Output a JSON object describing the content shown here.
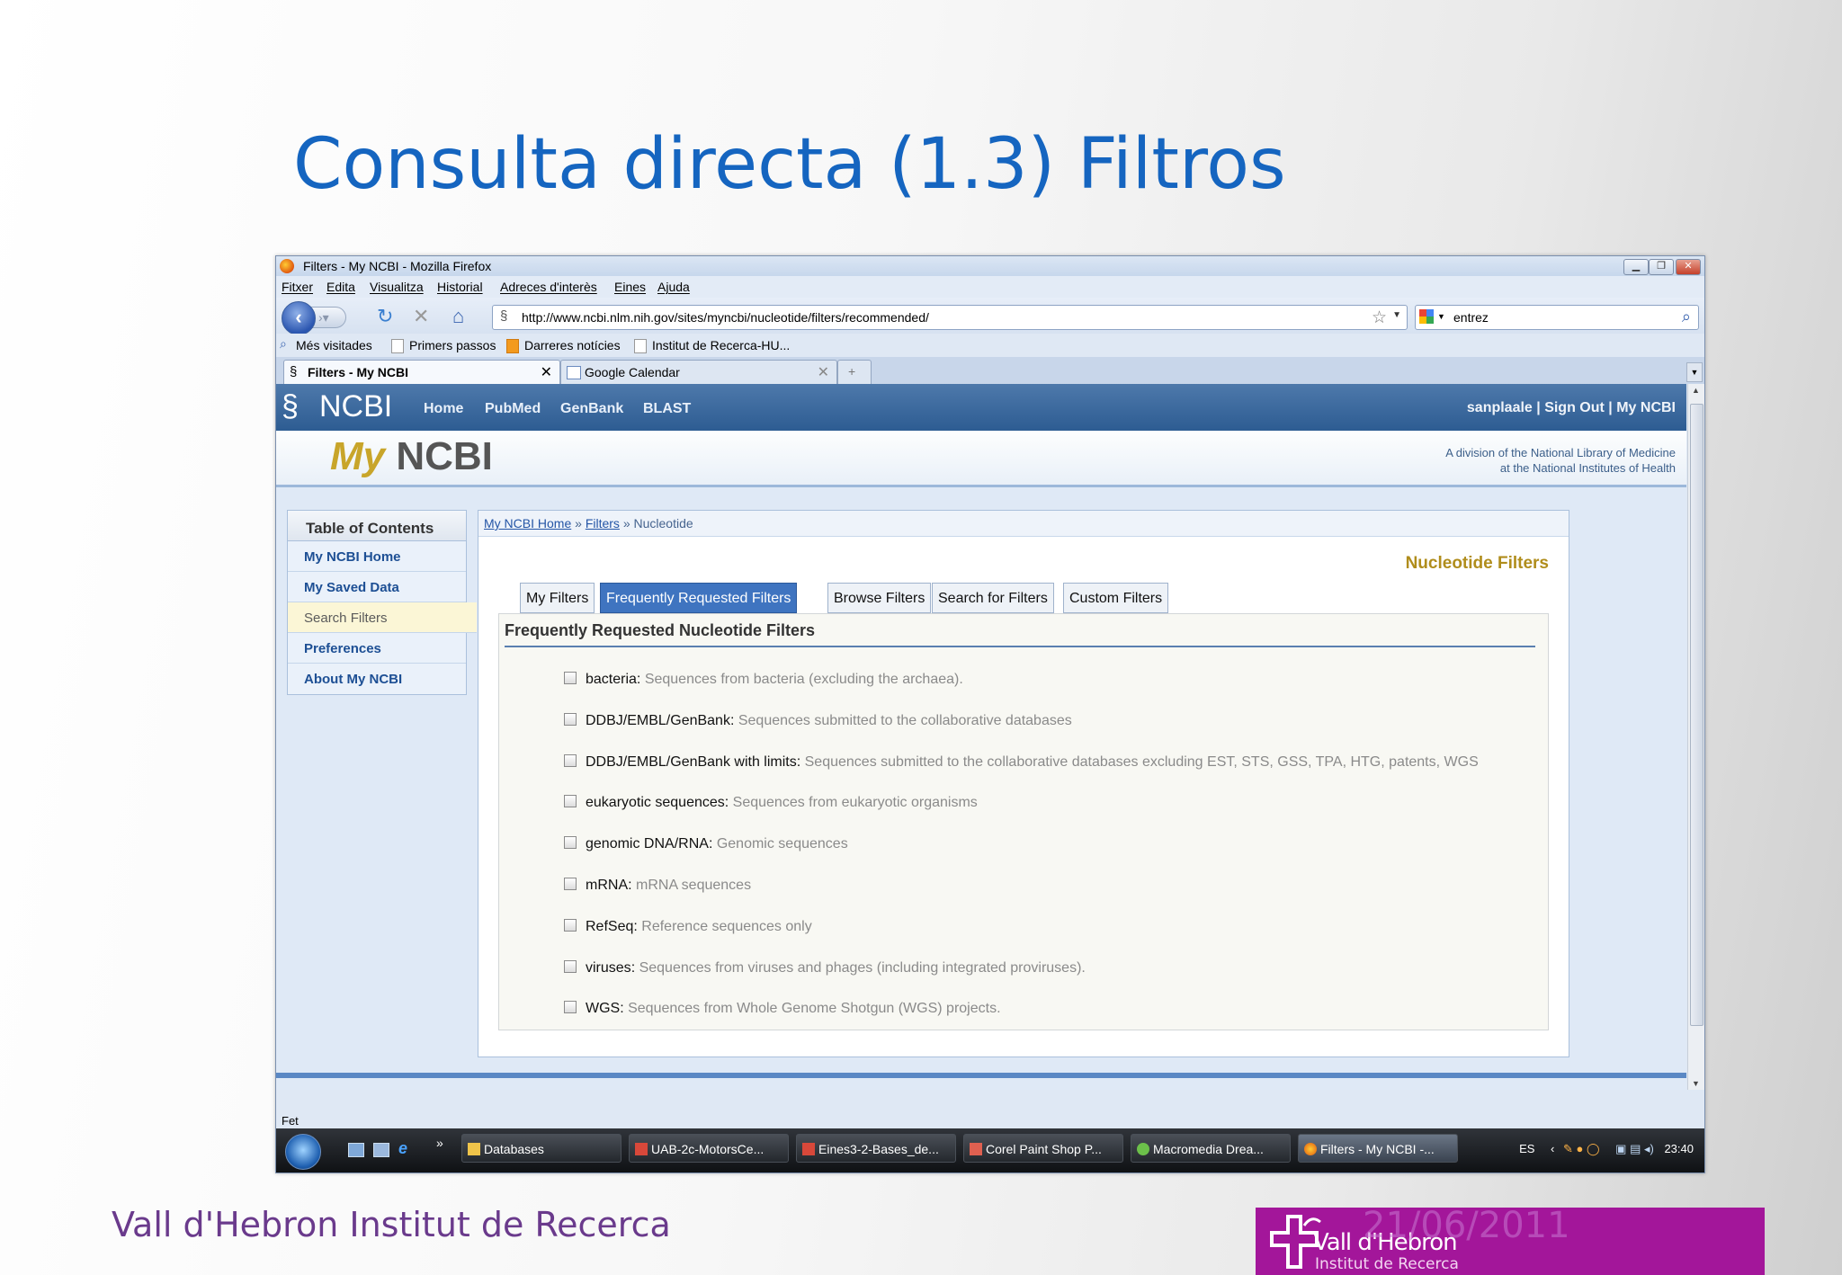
{
  "slide": {
    "title": "Consulta directa (1.3) Filtros",
    "footer_org": "Vall d'Hebron Institut de Recerca",
    "date": "21/06/2011",
    "logo_line1": "Vall d'Hebron",
    "logo_line2": "Institut de Recerca"
  },
  "browser": {
    "window_title": "Filters - My NCBI - Mozilla Firefox",
    "menu": [
      "Fitxer",
      "Edita",
      "Visualitza",
      "Historial",
      "Adreces d'interès",
      "Eines",
      "Ajuda"
    ],
    "url": "http://www.ncbi.nlm.nih.gov/sites/myncbi/nucleotide/filters/recommended/",
    "search_value": "entrez",
    "bookmarks": [
      "Més visitades",
      "Primers passos",
      "Darreres notícies",
      "Institut de Recerca-HU..."
    ],
    "tabs": [
      {
        "label": "Filters - My NCBI"
      },
      {
        "label": "Google Calendar"
      }
    ],
    "status": "Fet"
  },
  "ncbi": {
    "logo": "NCBI",
    "nav": [
      "Home",
      "PubMed",
      "GenBank",
      "BLAST"
    ],
    "user_links": "sanplaale | Sign Out | My NCBI",
    "myncbi_my": "My",
    "myncbi_ncbi": "NCBI",
    "division_line1": "A division of the National Library of Medicine",
    "division_line2": "at the National Institutes of Health"
  },
  "toc": {
    "heading": "Table of Contents",
    "items": [
      "My NCBI Home",
      "My Saved Data",
      "Search Filters",
      "Preferences",
      "About My NCBI"
    ]
  },
  "breadcrumb": {
    "home": "My NCBI Home",
    "sep1": "»",
    "filters": "Filters",
    "sep2": "»",
    "current": "Nucleotide"
  },
  "main": {
    "title": "Nucleotide Filters",
    "tabs": [
      "My Filters",
      "Frequently Requested Filters",
      "Browse Filters",
      "Search for Filters",
      "Custom Filters"
    ],
    "panel_heading": "Frequently Requested Nucleotide Filters",
    "filters": [
      {
        "name": "bacteria",
        "desc": "Sequences from bacteria (excluding the archaea)."
      },
      {
        "name": "DDBJ/EMBL/GenBank",
        "desc": "Sequences submitted to the collaborative databases"
      },
      {
        "name": "DDBJ/EMBL/GenBank with limits",
        "desc": "Sequences submitted to the collaborative databases excluding EST, STS, GSS, TPA, HTG, patents, WGS"
      },
      {
        "name": "eukaryotic sequences",
        "desc": "Sequences from eukaryotic organisms"
      },
      {
        "name": "genomic DNA/RNA",
        "desc": "Genomic sequences"
      },
      {
        "name": "mRNA",
        "desc": "mRNA sequences"
      },
      {
        "name": "RefSeq",
        "desc": "Reference sequences only"
      },
      {
        "name": "viruses",
        "desc": "Sequences from viruses and phages (including integrated proviruses)."
      },
      {
        "name": "WGS",
        "desc": "Sequences from Whole Genome Shotgun (WGS) projects."
      }
    ]
  },
  "taskbar": {
    "items": [
      "Databases",
      "UAB-2c-MotorsCe...",
      "Eines3-2-Bases_de...",
      "Corel Paint Shop P...",
      "Macromedia Drea...",
      "Filters - My NCBI -..."
    ],
    "lang": "ES",
    "time": "23:40"
  },
  "colors": {
    "title": "#1565c0",
    "ncbi_header": "#2d5c92",
    "active_tab": "#3f74c0",
    "nucleotide_title": "#b08d1c",
    "footer_logo": "#a3169a"
  }
}
